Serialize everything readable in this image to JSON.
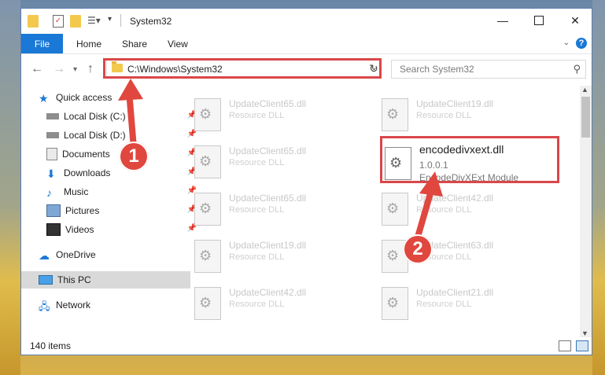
{
  "window": {
    "title": "System32",
    "controls": [
      "minimize",
      "maximize",
      "close"
    ]
  },
  "ribbon": {
    "tabs": [
      "File",
      "Home",
      "Share",
      "View"
    ]
  },
  "address": {
    "path": "C:\\Windows\\System32"
  },
  "search": {
    "placeholder": "Search System32"
  },
  "nav": {
    "items": [
      {
        "label": "Quick access",
        "icon": "star-icon"
      },
      {
        "label": "Local Disk (C:)",
        "icon": "drive-icon",
        "pinned": true
      },
      {
        "label": "Local Disk (D:)",
        "icon": "drive-icon",
        "pinned": true
      },
      {
        "label": "Documents",
        "icon": "documents-icon",
        "pinned": true
      },
      {
        "label": "Downloads",
        "icon": "download-icon",
        "pinned": true
      },
      {
        "label": "Music",
        "icon": "music-icon",
        "pinned": true
      },
      {
        "label": "Pictures",
        "icon": "pictures-icon",
        "pinned": true
      },
      {
        "label": "Videos",
        "icon": "videos-icon",
        "pinned": true
      },
      {
        "label": "OneDrive",
        "icon": "cloud-icon"
      },
      {
        "label": "This PC",
        "icon": "pc-icon",
        "selected": true
      },
      {
        "label": "Network",
        "icon": "network-icon"
      }
    ]
  },
  "files": {
    "left": [
      {
        "name": "UpdateClient65.dll",
        "type": "Resource DLL"
      },
      {
        "name": "UpdateClient65.dll",
        "type": "Resource DLL"
      },
      {
        "name": "UpdateClient65.dll",
        "type": "Resource DLL"
      },
      {
        "name": "UpdateClient19.dll",
        "type": "Resource DLL"
      },
      {
        "name": "UpdateClient42.dll",
        "type": "Resource DLL"
      }
    ],
    "right": [
      {
        "name": "UpdateClient19.dll",
        "type": "Resource DLL"
      },
      {
        "name": "encodedivxext.dll",
        "version": "1.0.0.1",
        "type": "EncodeDivXExt Module"
      },
      {
        "name": "UpdateClient42.dll",
        "type": "Resource DLL"
      },
      {
        "name": "UpdateClient63.dll",
        "type": "Resource DLL"
      },
      {
        "name": "UpdateClient21.dll",
        "type": "Resource DLL"
      }
    ]
  },
  "status": {
    "count": "140 items"
  },
  "annotations": {
    "step1": "1",
    "step2": "2",
    "color": "#e0473e"
  }
}
